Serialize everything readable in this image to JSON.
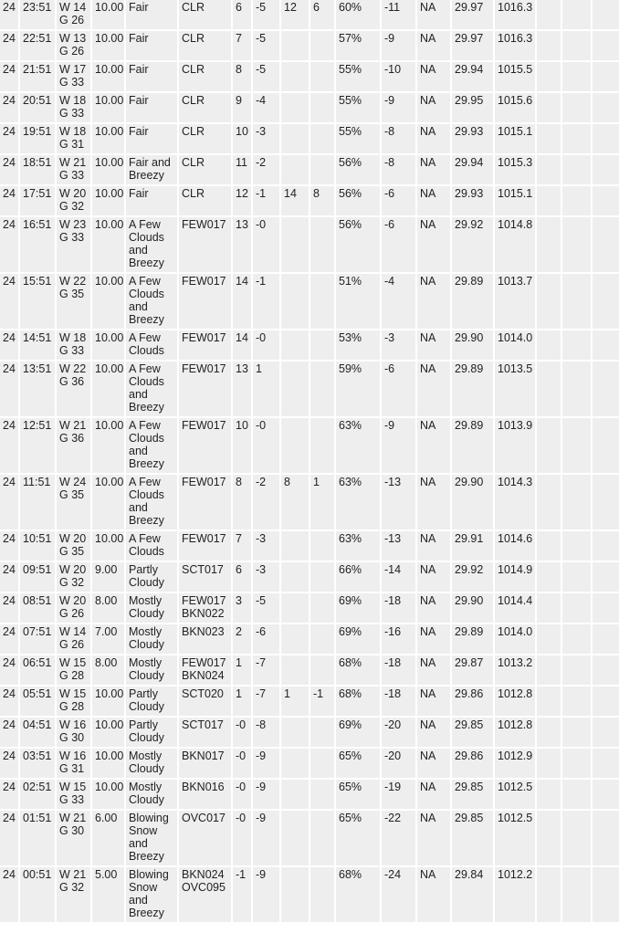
{
  "rows": [
    [
      "24",
      "23:51",
      "W 14\nG 26",
      "10.00",
      "Fair",
      "CLR",
      "6",
      "-5",
      "12",
      "6",
      "60%",
      "-11",
      "NA",
      "29.97",
      "1016.3",
      "",
      "",
      ""
    ],
    [
      "24",
      "22:51",
      "W 13\nG 26",
      "10.00",
      "Fair",
      "CLR",
      "7",
      "-5",
      "",
      "",
      "57%",
      "-9",
      "NA",
      "29.97",
      "1016.3",
      "",
      "",
      ""
    ],
    [
      "24",
      "21:51",
      "W 17\nG 33",
      "10.00",
      "Fair",
      "CLR",
      "8",
      "-5",
      "",
      "",
      "55%",
      "-10",
      "NA",
      "29.94",
      "1015.5",
      "",
      "",
      ""
    ],
    [
      "24",
      "20:51",
      "W 18\nG 33",
      "10.00",
      "Fair",
      "CLR",
      "9",
      "-4",
      "",
      "",
      "55%",
      "-9",
      "NA",
      "29.95",
      "1015.6",
      "",
      "",
      ""
    ],
    [
      "24",
      "19:51",
      "W 18\nG 31",
      "10.00",
      "Fair",
      "CLR",
      "10",
      "-3",
      "",
      "",
      "55%",
      "-8",
      "NA",
      "29.93",
      "1015.1",
      "",
      "",
      ""
    ],
    [
      "24",
      "18:51",
      "W 21\nG 33",
      "10.00",
      "Fair and\nBreezy",
      "CLR",
      "11",
      "-2",
      "",
      "",
      "56%",
      "-8",
      "NA",
      "29.94",
      "1015.3",
      "",
      "",
      ""
    ],
    [
      "24",
      "17:51",
      "W 20\nG 32",
      "10.00",
      "Fair",
      "CLR",
      "12",
      "-1",
      "14",
      "8",
      "56%",
      "-6",
      "NA",
      "29.93",
      "1015.1",
      "",
      "",
      ""
    ],
    [
      "24",
      "16:51",
      "W 23\nG 33",
      "10.00",
      "A Few\nClouds\nand\nBreezy",
      "FEW017",
      "13",
      "-0",
      "",
      "",
      "56%",
      "-6",
      "NA",
      "29.92",
      "1014.8",
      "",
      "",
      ""
    ],
    [
      "24",
      "15:51",
      "W 22\nG 35",
      "10.00",
      "A Few\nClouds\nand\nBreezy",
      "FEW017",
      "14",
      "-1",
      "",
      "",
      "51%",
      "-4",
      "NA",
      "29.89",
      "1013.7",
      "",
      "",
      ""
    ],
    [
      "24",
      "14:51",
      "W 18\nG 33",
      "10.00",
      "A Few\nClouds",
      "FEW017",
      "14",
      "-0",
      "",
      "",
      "53%",
      "-3",
      "NA",
      "29.90",
      "1014.0",
      "",
      "",
      ""
    ],
    [
      "24",
      "13:51",
      "W 22\nG 36",
      "10.00",
      "A Few\nClouds\nand\nBreezy",
      "FEW017",
      "13",
      "1",
      "",
      "",
      "59%",
      "-6",
      "NA",
      "29.89",
      "1013.5",
      "",
      "",
      ""
    ],
    [
      "24",
      "12:51",
      "W 21\nG 36",
      "10.00",
      "A Few\nClouds\nand\nBreezy",
      "FEW017",
      "10",
      "-0",
      "",
      "",
      "63%",
      "-9",
      "NA",
      "29.89",
      "1013.9",
      "",
      "",
      ""
    ],
    [
      "24",
      "11:51",
      "W 24\nG 35",
      "10.00",
      "A Few\nClouds\nand\nBreezy",
      "FEW017",
      "8",
      "-2",
      "8",
      "1",
      "63%",
      "-13",
      "NA",
      "29.90",
      "1014.3",
      "",
      "",
      ""
    ],
    [
      "24",
      "10:51",
      "W 20\nG 35",
      "10.00",
      "A Few\nClouds",
      "FEW017",
      "7",
      "-3",
      "",
      "",
      "63%",
      "-13",
      "NA",
      "29.91",
      "1014.6",
      "",
      "",
      ""
    ],
    [
      "24",
      "09:51",
      "W 20\nG 32",
      "9.00",
      "Partly\nCloudy",
      "SCT017",
      "6",
      "-3",
      "",
      "",
      "66%",
      "-14",
      "NA",
      "29.92",
      "1014.9",
      "",
      "",
      ""
    ],
    [
      "24",
      "08:51",
      "W 20\nG 26",
      "8.00",
      "Mostly\nCloudy",
      "FEW017\nBKN022",
      "3",
      "-5",
      "",
      "",
      "69%",
      "-18",
      "NA",
      "29.90",
      "1014.4",
      "",
      "",
      ""
    ],
    [
      "24",
      "07:51",
      "W 14\nG 26",
      "7.00",
      "Mostly\nCloudy",
      "BKN023",
      "2",
      "-6",
      "",
      "",
      "69%",
      "-16",
      "NA",
      "29.89",
      "1014.0",
      "",
      "",
      ""
    ],
    [
      "24",
      "06:51",
      "W 15\nG 28",
      "8.00",
      "Mostly\nCloudy",
      "FEW017\nBKN024",
      "1",
      "-7",
      "",
      "",
      "68%",
      "-18",
      "NA",
      "29.87",
      "1013.2",
      "",
      "",
      ""
    ],
    [
      "24",
      "05:51",
      "W 15\nG 28",
      "10.00",
      "Partly\nCloudy",
      "SCT020",
      "1",
      "-7",
      "1",
      "-1",
      "68%",
      "-18",
      "NA",
      "29.86",
      "1012.8",
      "",
      "",
      ""
    ],
    [
      "24",
      "04:51",
      "W 16\nG 30",
      "10.00",
      "Partly\nCloudy",
      "SCT017",
      "-0",
      "-8",
      "",
      "",
      "69%",
      "-20",
      "NA",
      "29.85",
      "1012.8",
      "",
      "",
      ""
    ],
    [
      "24",
      "03:51",
      "W 16\nG 31",
      "10.00",
      "Mostly\nCloudy",
      "BKN017",
      "-0",
      "-9",
      "",
      "",
      "65%",
      "-20",
      "NA",
      "29.86",
      "1012.9",
      "",
      "",
      ""
    ],
    [
      "24",
      "02:51",
      "W 15\nG 33",
      "10.00",
      "Mostly\nCloudy",
      "BKN016",
      "-0",
      "-9",
      "",
      "",
      "65%",
      "-19",
      "NA",
      "29.85",
      "1012.5",
      "",
      "",
      ""
    ],
    [
      "24",
      "01:51",
      "W 21\nG 30",
      "6.00",
      "Blowing\nSnow\nand\nBreezy",
      "OVC017",
      "-0",
      "-9",
      "",
      "",
      "65%",
      "-22",
      "NA",
      "29.85",
      "1012.5",
      "",
      "",
      ""
    ],
    [
      "24",
      "00:51",
      "W 21\nG 32",
      "5.00",
      "Blowing\nSnow\nand\nBreezy",
      "BKN024\nOVC095",
      "-1",
      "-9",
      "",
      "",
      "68%",
      "-24",
      "NA",
      "29.84",
      "1012.2",
      "",
      "",
      ""
    ]
  ]
}
